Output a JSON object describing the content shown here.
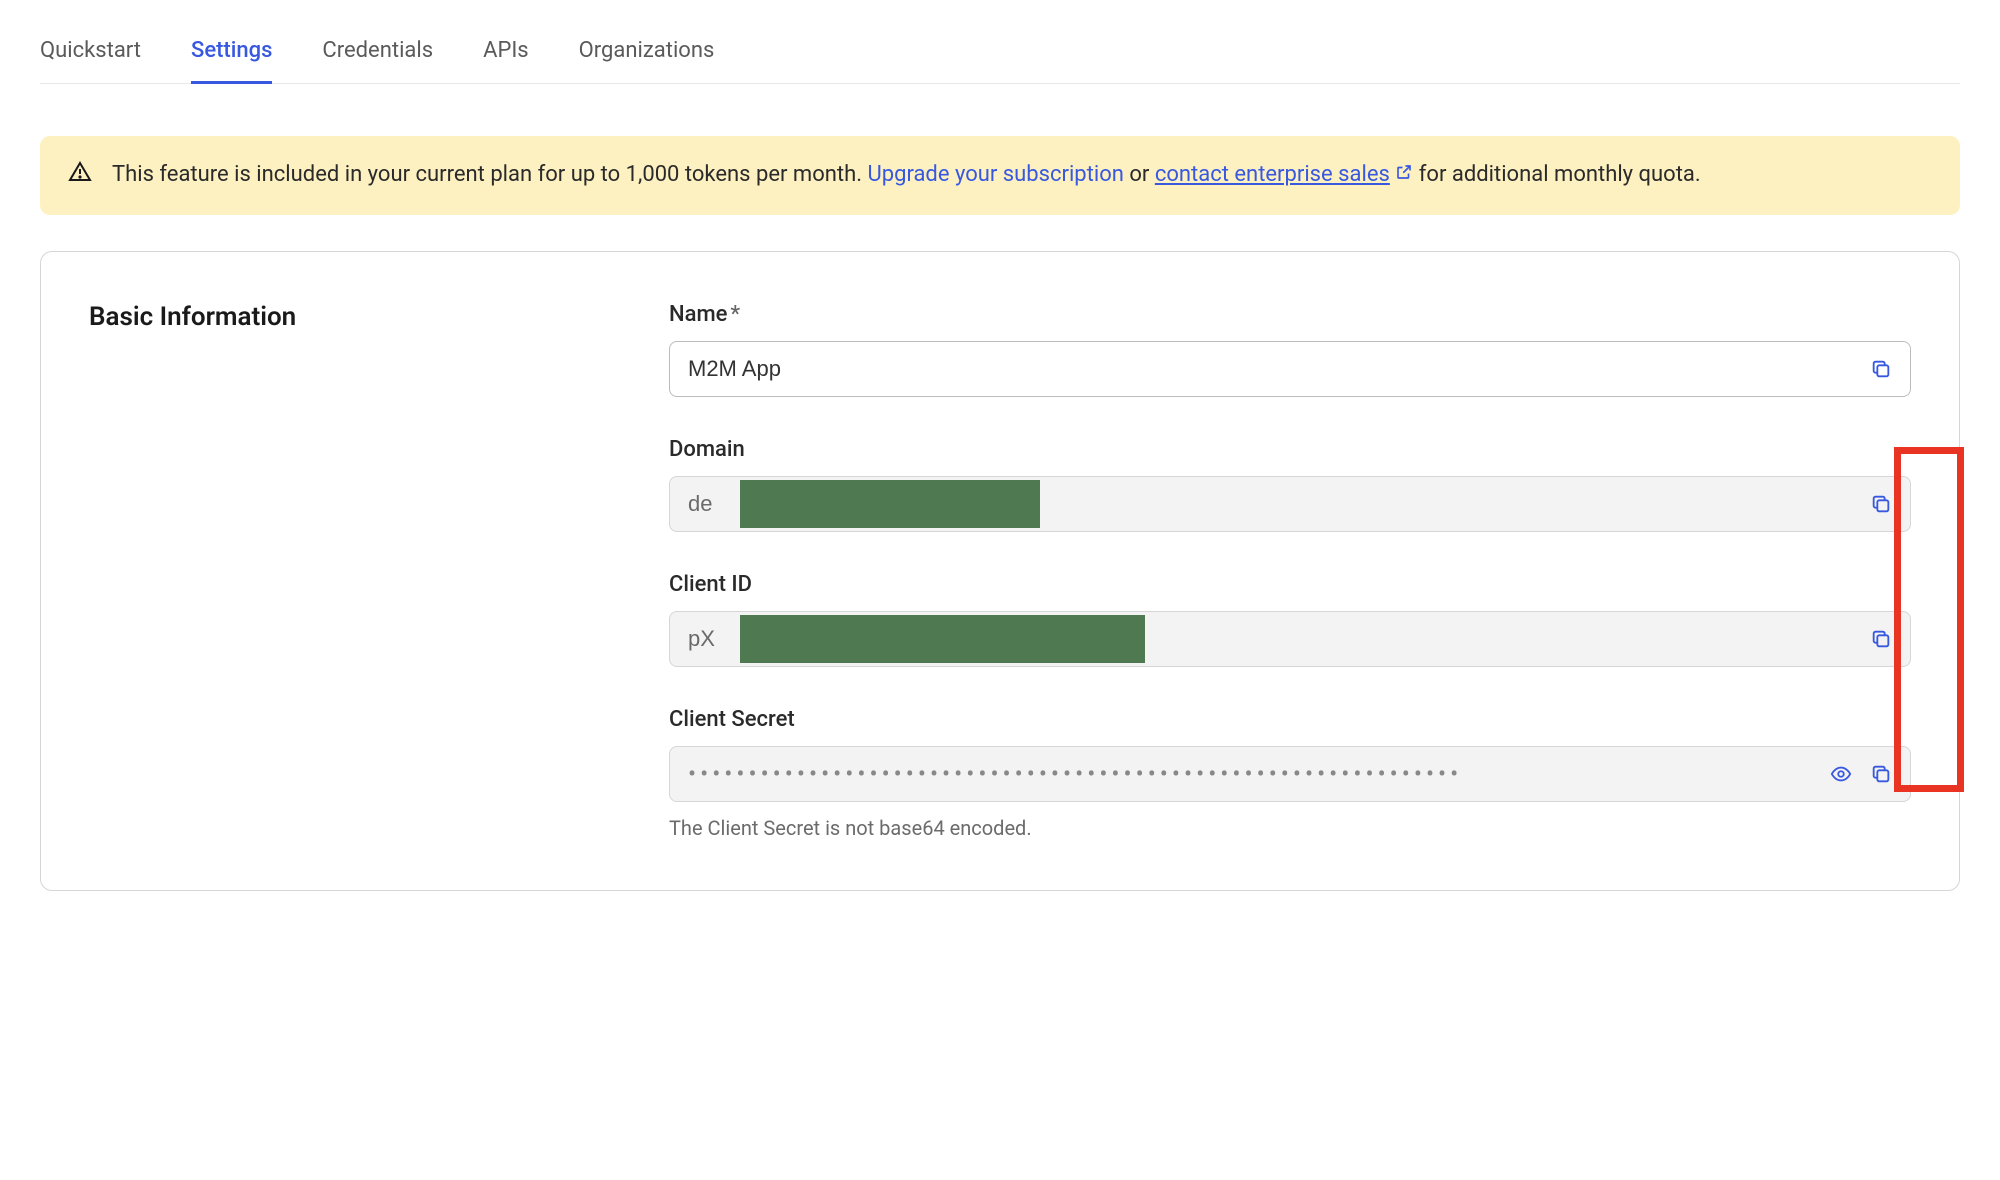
{
  "tabs": {
    "items": [
      {
        "label": "Quickstart"
      },
      {
        "label": "Settings"
      },
      {
        "label": "Credentials"
      },
      {
        "label": "APIs"
      },
      {
        "label": "Organizations"
      }
    ],
    "activeIndex": 1
  },
  "alert": {
    "text_pre": "This feature is included in your current plan for up to 1,000 tokens per month. ",
    "link_upgrade": "Upgrade your subscription",
    "text_or": " or ",
    "link_sales": "contact enterprise sales",
    "text_post": " for additional monthly quota."
  },
  "section": {
    "title": "Basic Information"
  },
  "fields": {
    "name": {
      "label": "Name",
      "required": "*",
      "value": "M2M App"
    },
    "domain": {
      "label": "Domain",
      "value": "de"
    },
    "client_id": {
      "label": "Client ID",
      "value": "pX"
    },
    "client_secret": {
      "label": "Client Secret",
      "masked": "••••••••••••••••••••••••••••••••••••••••••••••••••••••••••••••••",
      "helper": "The Client Secret is not base64 encoded."
    }
  }
}
